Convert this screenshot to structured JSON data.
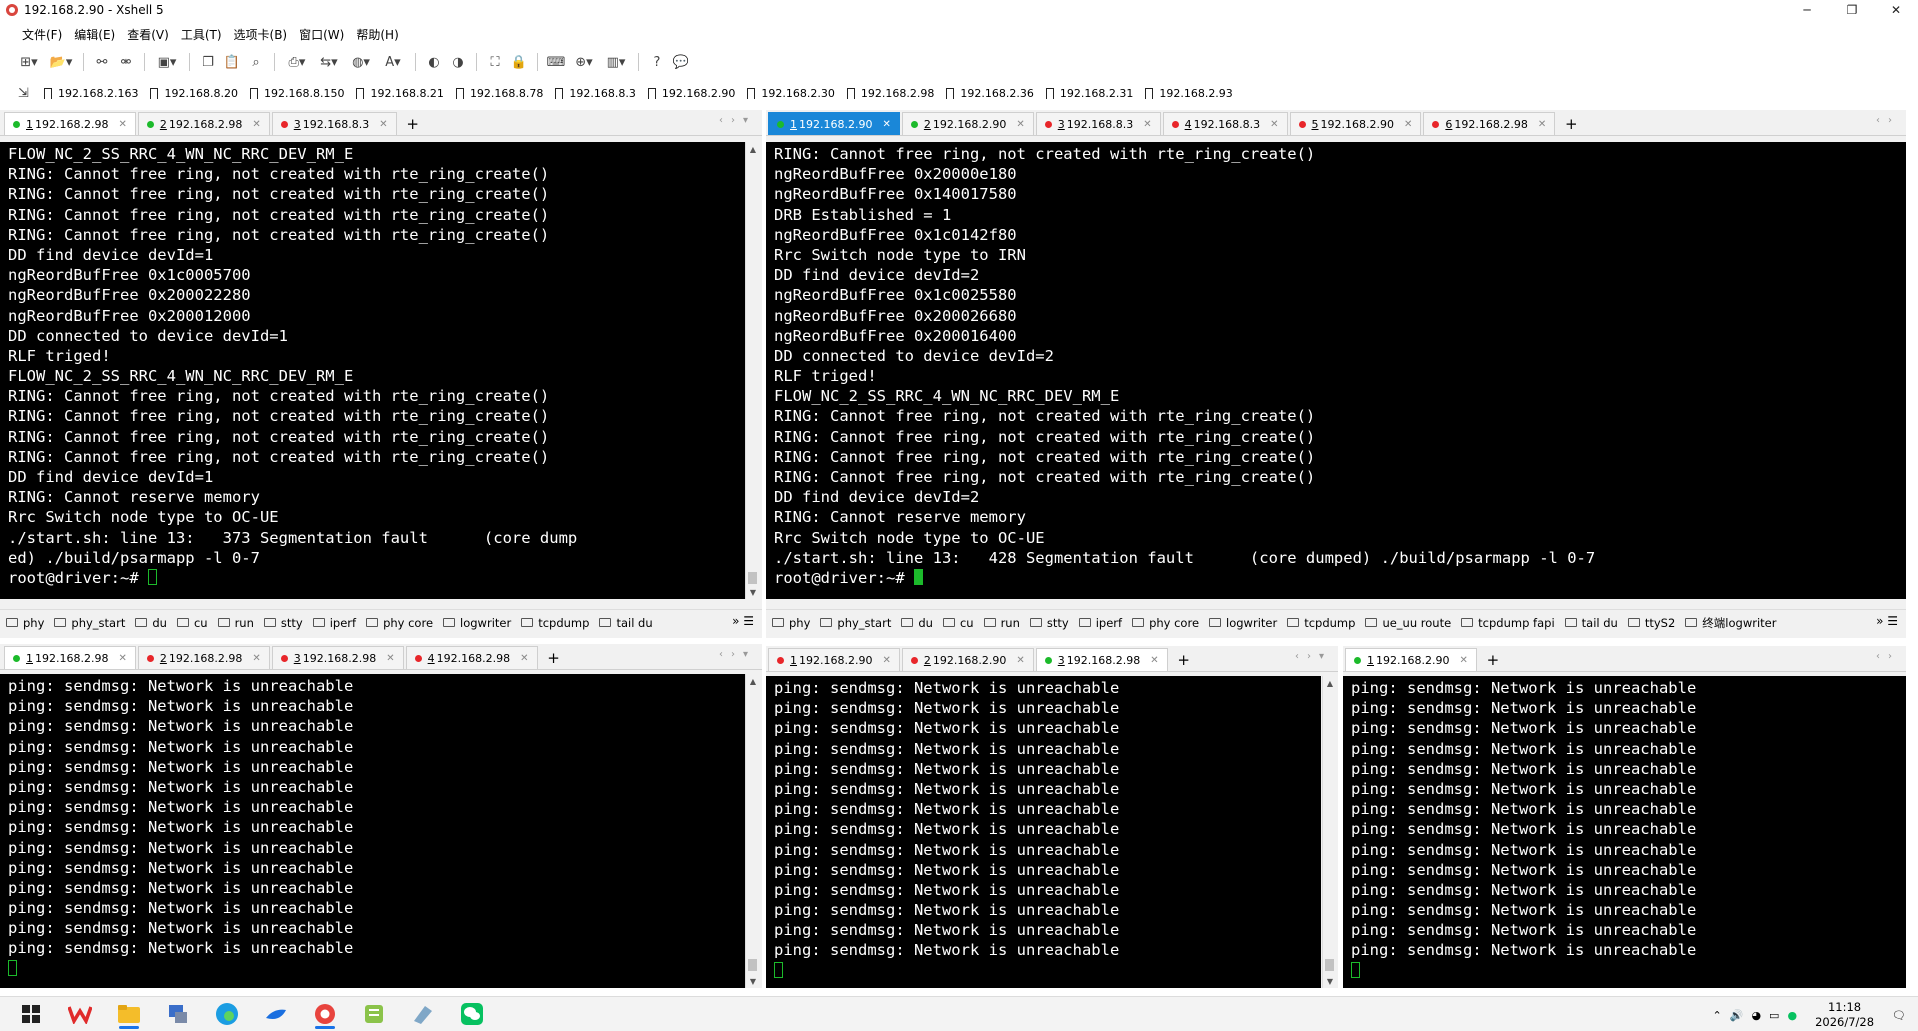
{
  "window": {
    "title": "192.168.2.90 - Xshell 5",
    "min": "─",
    "max": "❐",
    "close": "✕"
  },
  "menu": [
    "文件(F)",
    "编辑(E)",
    "查看(V)",
    "工具(T)",
    "选项卡(B)",
    "窗口(W)",
    "帮助(H)"
  ],
  "toolbar_icons": [
    "new-session-icon",
    "open-folder-icon",
    "reconnect-icon",
    "disconnect-icon",
    "properties-icon",
    "copy-icon",
    "paste-icon",
    "find-icon",
    "print-icon",
    "transfer-icon",
    "globe-icon",
    "font-icon",
    "xftp-icon",
    "xmanager-icon",
    "fullscreen-icon",
    "lock-icon",
    "keyboard-icon",
    "new-tab-icon",
    "layout-icon",
    "help-icon",
    "chat-icon"
  ],
  "quick_sessions": [
    "192.168.2.163",
    "192.168.8.20",
    "192.168.8.150",
    "192.168.8.21",
    "192.168.8.78",
    "192.168.8.3",
    "192.168.2.90",
    "192.168.2.30",
    "192.168.2.98",
    "192.168.2.36",
    "192.168.2.31",
    "192.168.2.93"
  ],
  "panes": {
    "top_left": {
      "tabs": [
        {
          "num": "1",
          "host": "192.168.2.98",
          "status": "green",
          "active": true
        },
        {
          "num": "2",
          "host": "192.168.2.98",
          "status": "green",
          "active": false
        },
        {
          "num": "3",
          "host": "192.168.8.3",
          "status": "red",
          "active": false
        }
      ],
      "lines": [
        "FLOW_NC_2_SS_RRC_4_WN_NC_RRC_DEV_RM_E",
        "RING: Cannot free ring, not created with rte_ring_create()",
        "RING: Cannot free ring, not created with rte_ring_create()",
        "RING: Cannot free ring, not created with rte_ring_create()",
        "RING: Cannot free ring, not created with rte_ring_create()",
        "DD find device devId=1",
        "ngReordBufFree 0x1c0005700",
        "ngReordBufFree 0x200022280",
        "ngReordBufFree 0x200012000",
        "DD connected to device devId=1",
        "RLF triged!",
        "FLOW_NC_2_SS_RRC_4_WN_NC_RRC_DEV_RM_E",
        "RING: Cannot free ring, not created with rte_ring_create()",
        "RING: Cannot free ring, not created with rte_ring_create()",
        "RING: Cannot free ring, not created with rte_ring_create()",
        "RING: Cannot free ring, not created with rte_ring_create()",
        "DD find device devId=1",
        "RING: Cannot reserve memory",
        "Rrc Switch node type to OC-UE",
        "./start.sh: line 13:   373 Segmentation fault      (core dump",
        "ed) ./build/psarmapp -l 0-7"
      ],
      "prompt": "root@driver:~# ",
      "commands": [
        "phy",
        "phy_start",
        "du",
        "cu",
        "run",
        "stty",
        "iperf",
        "phy core",
        "logwriter",
        "tcpdump",
        "tail du"
      ]
    },
    "top_right": {
      "tabs": [
        {
          "num": "1",
          "host": "192.168.2.90",
          "status": "green",
          "active": true
        },
        {
          "num": "2",
          "host": "192.168.2.90",
          "status": "green",
          "active": false
        },
        {
          "num": "3",
          "host": "192.168.8.3",
          "status": "red",
          "active": false
        },
        {
          "num": "4",
          "host": "192.168.8.3",
          "status": "red",
          "active": false
        },
        {
          "num": "5",
          "host": "192.168.2.90",
          "status": "red",
          "active": false
        },
        {
          "num": "6",
          "host": "192.168.2.98",
          "status": "red",
          "active": false
        }
      ],
      "lines": [
        "RING: Cannot free ring, not created with rte_ring_create()",
        "ngReordBufFree 0x20000e180",
        "ngReordBufFree 0x140017580",
        "DRB Established = 1",
        "ngReordBufFree 0x1c0142f80",
        "Rrc Switch node type to IRN",
        "DD find device devId=2",
        "ngReordBufFree 0x1c0025580",
        "ngReordBufFree 0x200026680",
        "ngReordBufFree 0x200016400",
        "DD connected to device devId=2",
        "RLF triged!",
        "FLOW_NC_2_SS_RRC_4_WN_NC_RRC_DEV_RM_E",
        "RING: Cannot free ring, not created with rte_ring_create()",
        "RING: Cannot free ring, not created with rte_ring_create()",
        "RING: Cannot free ring, not created with rte_ring_create()",
        "RING: Cannot free ring, not created with rte_ring_create()",
        "DD find device devId=2",
        "RING: Cannot reserve memory",
        "Rrc Switch node type to OC-UE",
        "./start.sh: line 13:   428 Segmentation fault      (core dumped) ./build/psarmapp -l 0-7"
      ],
      "prompt": "root@driver:~# ",
      "commands": [
        "phy",
        "phy_start",
        "du",
        "cu",
        "run",
        "stty",
        "iperf",
        "phy core",
        "logwriter",
        "tcpdump",
        "ue_uu route",
        "tcpdump fapi",
        "tail du",
        "ttyS2",
        "终端logwriter"
      ]
    },
    "bottom_left": {
      "tabs": [
        {
          "num": "1",
          "host": "192.168.2.98",
          "status": "green",
          "active": true
        },
        {
          "num": "2",
          "host": "192.168.2.98",
          "status": "red",
          "active": false
        },
        {
          "num": "3",
          "host": "192.168.2.98",
          "status": "red",
          "active": false
        },
        {
          "num": "4",
          "host": "192.168.2.98",
          "status": "red",
          "active": false
        }
      ],
      "line": "ping: sendmsg: Network is unreachable",
      "count": 14
    },
    "bottom_mid": {
      "tabs": [
        {
          "num": "1",
          "host": "192.168.2.90",
          "status": "red",
          "active": false
        },
        {
          "num": "2",
          "host": "192.168.2.90",
          "status": "red",
          "active": false
        },
        {
          "num": "3",
          "host": "192.168.2.98",
          "status": "green",
          "active": true
        }
      ],
      "line": "ping: sendmsg: Network is unreachable",
      "count": 14
    },
    "bottom_right": {
      "tabs": [
        {
          "num": "1",
          "host": "192.168.2.90",
          "status": "green",
          "active": true
        }
      ],
      "line": "ping: sendmsg: Network is unreachable",
      "count": 14
    }
  },
  "taskbar": {
    "apps": [
      "windows-start-icon",
      "wps-icon",
      "file-explorer-icon",
      "network-app-icon",
      "edge-icon",
      "feishu-icon",
      "xshell-icon",
      "notepad-icon",
      "tool-icon",
      "wechat-icon"
    ],
    "time": "11:18",
    "date": "2026/7/28"
  }
}
